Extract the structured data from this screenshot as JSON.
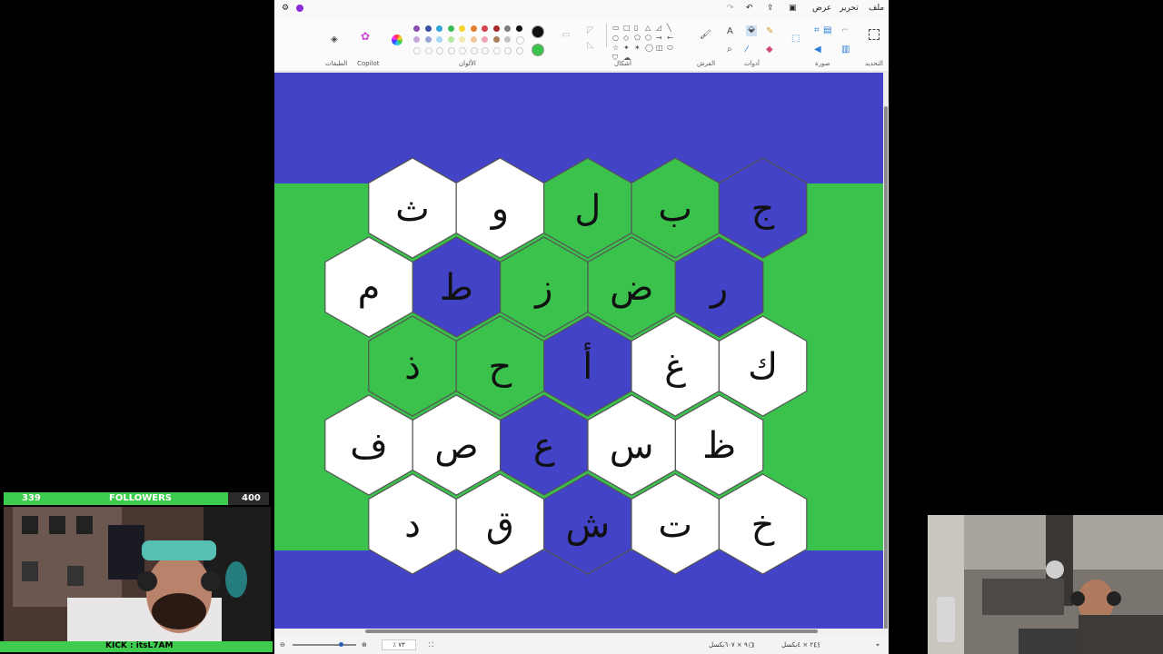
{
  "menu": {
    "file": "ملف",
    "edit": "تحرير",
    "view": "عرض"
  },
  "ribbon": {
    "select_label": "التحديد",
    "image_label": "صورة",
    "tools_label": "أدوات",
    "brushes_label": "الفرش",
    "shapes_label": "أشكال",
    "colors_label": "الألوان",
    "copilot_label": "Copilot",
    "layers_label": "الطبقات",
    "palette": [
      "#111111",
      "#7d7d7d",
      "#a7272a",
      "#d3424e",
      "#e37f31",
      "#f7d531",
      "#3dbd59",
      "#33a5dd",
      "#3b50a8",
      "#8a4cb1",
      "#ffffff",
      "#c3c3c3",
      "#a77d58",
      "#f2a3b6",
      "#f2c89a",
      "#f3eab0",
      "#b9e6a1",
      "#a3d8f0",
      "#99a5d9",
      "#c7a6de"
    ],
    "primary_color": "#111111",
    "secondary_color": "#3ac24d"
  },
  "board": {
    "background_blue": "#4343c8",
    "band_green": "#3ac24d",
    "fill_colors": {
      "W": "#ffffff",
      "G": "#3ac24d",
      "B": "#4343c8"
    },
    "rows": [
      [
        {
          "letter": "ث",
          "fill": "W"
        },
        {
          "letter": "و",
          "fill": "W"
        },
        {
          "letter": "ل",
          "fill": "G"
        },
        {
          "letter": "ب",
          "fill": "G"
        },
        {
          "letter": "ج",
          "fill": "B"
        }
      ],
      [
        {
          "letter": "م",
          "fill": "W"
        },
        {
          "letter": "ط",
          "fill": "B"
        },
        {
          "letter": "ز",
          "fill": "G"
        },
        {
          "letter": "ض",
          "fill": "G"
        },
        {
          "letter": "ر",
          "fill": "B"
        }
      ],
      [
        {
          "letter": "ذ",
          "fill": "G"
        },
        {
          "letter": "ح",
          "fill": "G"
        },
        {
          "letter": "أ",
          "fill": "B"
        },
        {
          "letter": "غ",
          "fill": "W"
        },
        {
          "letter": "ك",
          "fill": "W"
        }
      ],
      [
        {
          "letter": "ف",
          "fill": "W"
        },
        {
          "letter": "ص",
          "fill": "W"
        },
        {
          "letter": "ع",
          "fill": "B"
        },
        {
          "letter": "س",
          "fill": "W"
        },
        {
          "letter": "ظ",
          "fill": "W"
        }
      ],
      [
        {
          "letter": "د",
          "fill": "W"
        },
        {
          "letter": "ق",
          "fill": "W"
        },
        {
          "letter": "ش",
          "fill": "B"
        },
        {
          "letter": "ت",
          "fill": "W"
        },
        {
          "letter": "خ",
          "fill": "W"
        }
      ]
    ]
  },
  "status": {
    "canvas_size": "٩٠١ × ٦٠٧بكسل",
    "selection_size": "٢٤١ × ٤بكسل",
    "zoom": "٪ ٧٣"
  },
  "overlay": {
    "followers_current": "339",
    "followers_label": "FOLLOWERS",
    "followers_goal": "400",
    "followers_progress": 0.8475,
    "kick_tag": "KICK : itsL7AM"
  }
}
